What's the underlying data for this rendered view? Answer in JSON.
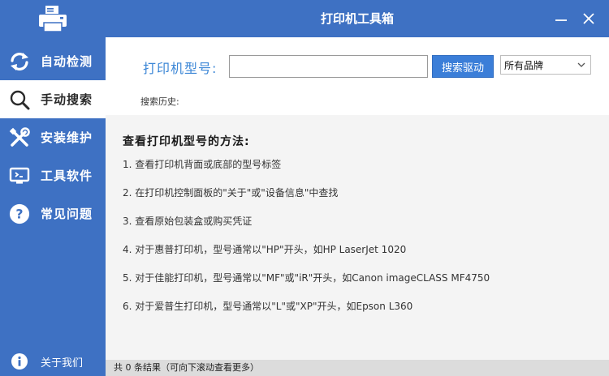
{
  "window": {
    "title": "打印机工具箱"
  },
  "sidebar": {
    "items": [
      {
        "label": "自动检测",
        "icon": "refresh-icon"
      },
      {
        "label": "手动搜索",
        "icon": "search-icon"
      },
      {
        "label": "安装维护",
        "icon": "tools-icon"
      },
      {
        "label": "工具软件",
        "icon": "monitor-icon"
      },
      {
        "label": "常见问题",
        "icon": "question-icon"
      }
    ],
    "active_index": 1,
    "about": {
      "label": "关于我们",
      "icon": "info-icon"
    }
  },
  "search": {
    "label": "打印机型号:",
    "input_value": "",
    "button_label": "搜索驱动",
    "brand_selected": "所有品牌",
    "history_label": "搜索历史:"
  },
  "help": {
    "title": "查看打印机型号的方法:",
    "items": [
      "1. 查看打印机背面或底部的型号标签",
      "2. 在打印机控制面板的\"关于\"或\"设备信息\"中查找",
      "3. 查看原始包装盒或购买凭证",
      "4. 对于惠普打印机，型号通常以\"HP\"开头，如HP LaserJet 1020",
      "5. 对于佳能打印机，型号通常以\"MF\"或\"iR\"开头，如Canon imageCLASS MF4750",
      "6. 对于爱普生打印机，型号通常以\"L\"或\"XP\"开头，如Epson L360"
    ]
  },
  "status": {
    "text": "共 0 条结果（可向下滚动查看更多）"
  },
  "colors": {
    "primary": "#3e71c3",
    "accent": "#3b86d6",
    "content_bg": "#f4f4f4"
  }
}
